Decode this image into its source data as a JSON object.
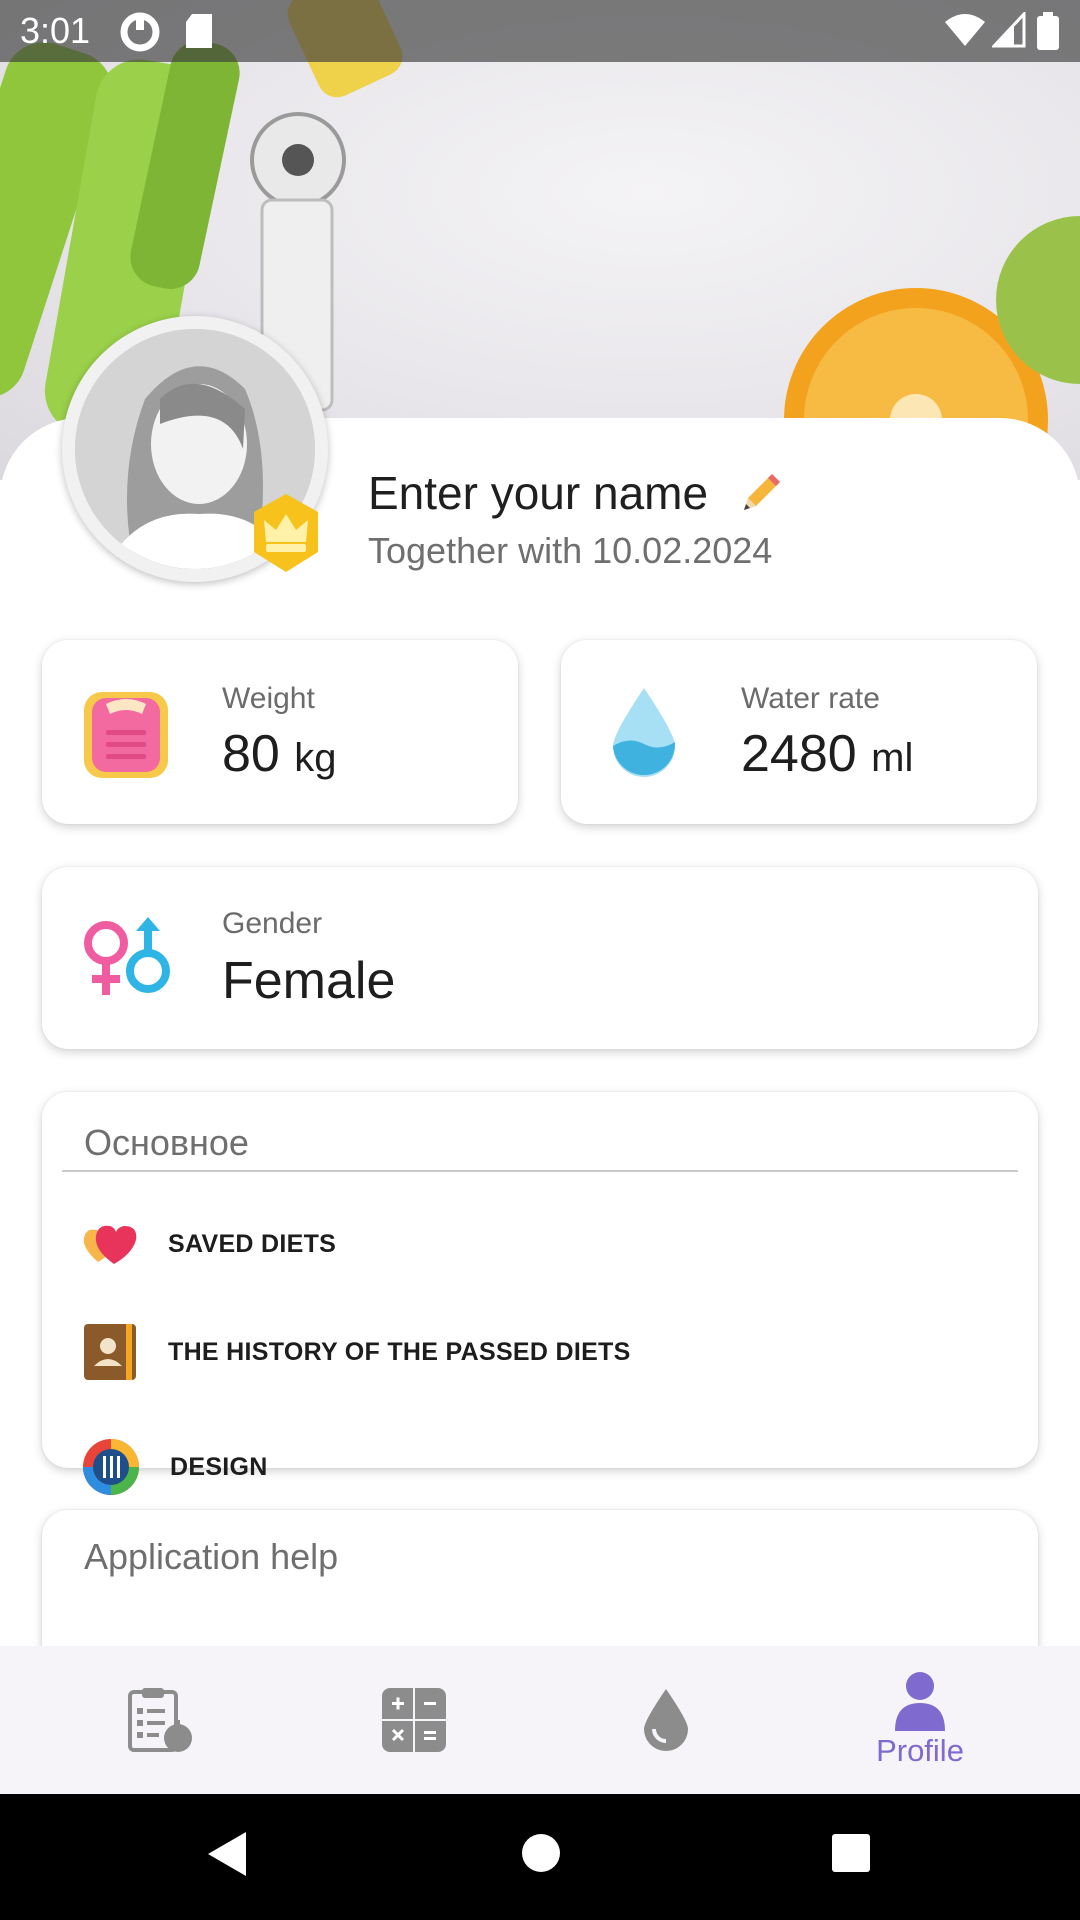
{
  "status_bar": {
    "time": "3:01"
  },
  "profile": {
    "name_placeholder": "Enter your name",
    "since_text": "Together with 10.02.2024"
  },
  "stats": {
    "weight": {
      "label": "Weight",
      "value": "80",
      "unit": "kg"
    },
    "water": {
      "label": "Water rate",
      "value": "2480",
      "unit": "ml"
    },
    "gender": {
      "label": "Gender",
      "value": "Female"
    }
  },
  "main_section": {
    "title": "Основное",
    "items": [
      {
        "label": "SAVED DIETS",
        "icon": "hearts-icon"
      },
      {
        "label": "THE HISTORY OF THE PASSED DIETS",
        "icon": "contact-book-icon"
      },
      {
        "label": "DESIGN",
        "icon": "palette-icon"
      }
    ]
  },
  "help_section": {
    "title": "Application help"
  },
  "bottom_nav": {
    "items": [
      {
        "name": "diets",
        "icon": "clipboard-apple-icon"
      },
      {
        "name": "calculator",
        "icon": "calculator-icon"
      },
      {
        "name": "water",
        "icon": "water-drop-icon"
      },
      {
        "name": "profile",
        "icon": "person-icon",
        "label": "Profile",
        "active": true
      }
    ]
  },
  "colors": {
    "accent": "#7f6bd0",
    "nav_bg": "#f6f4f8"
  }
}
